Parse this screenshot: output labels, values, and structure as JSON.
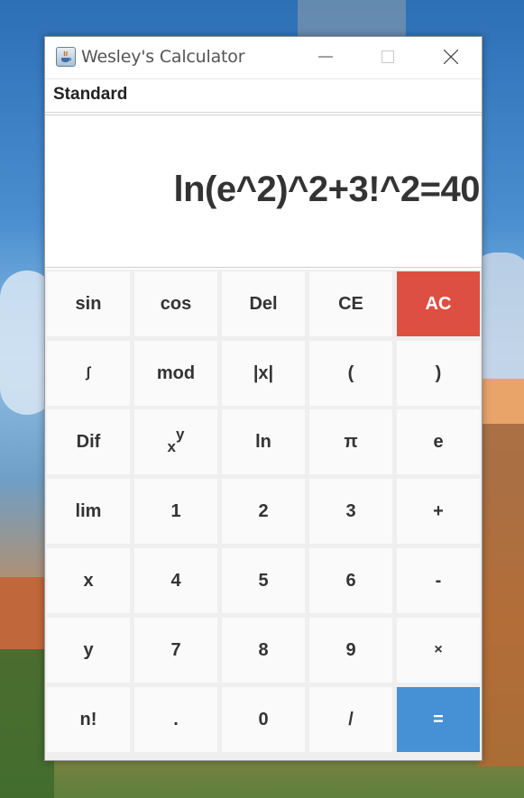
{
  "window": {
    "title": "Wesley's Calculator"
  },
  "mode": {
    "label": "Standard"
  },
  "display": {
    "expression": "ln(e^2)^2+3!^2=40"
  },
  "keys": {
    "sin": "sin",
    "cos": "cos",
    "del": "Del",
    "ce": "CE",
    "ac": "AC",
    "integral": "∫",
    "mod": "mod",
    "abs": "|x|",
    "lparen": "(",
    "rparen": ")",
    "dif": "Dif",
    "pow_base": "x",
    "pow_exp": "y",
    "ln": "ln",
    "pi": "π",
    "e": "e",
    "lim": "lim",
    "one": "1",
    "two": "2",
    "three": "3",
    "plus": "+",
    "x": "x",
    "four": "4",
    "five": "5",
    "six": "6",
    "minus": "-",
    "y": "y",
    "seven": "7",
    "eight": "8",
    "nine": "9",
    "times": "×",
    "factorial": "n!",
    "dot": ".",
    "zero": "0",
    "divide": "/",
    "equals": "="
  },
  "colors": {
    "ac_key": "#dd4f43",
    "equals_key": "#4691d6"
  }
}
